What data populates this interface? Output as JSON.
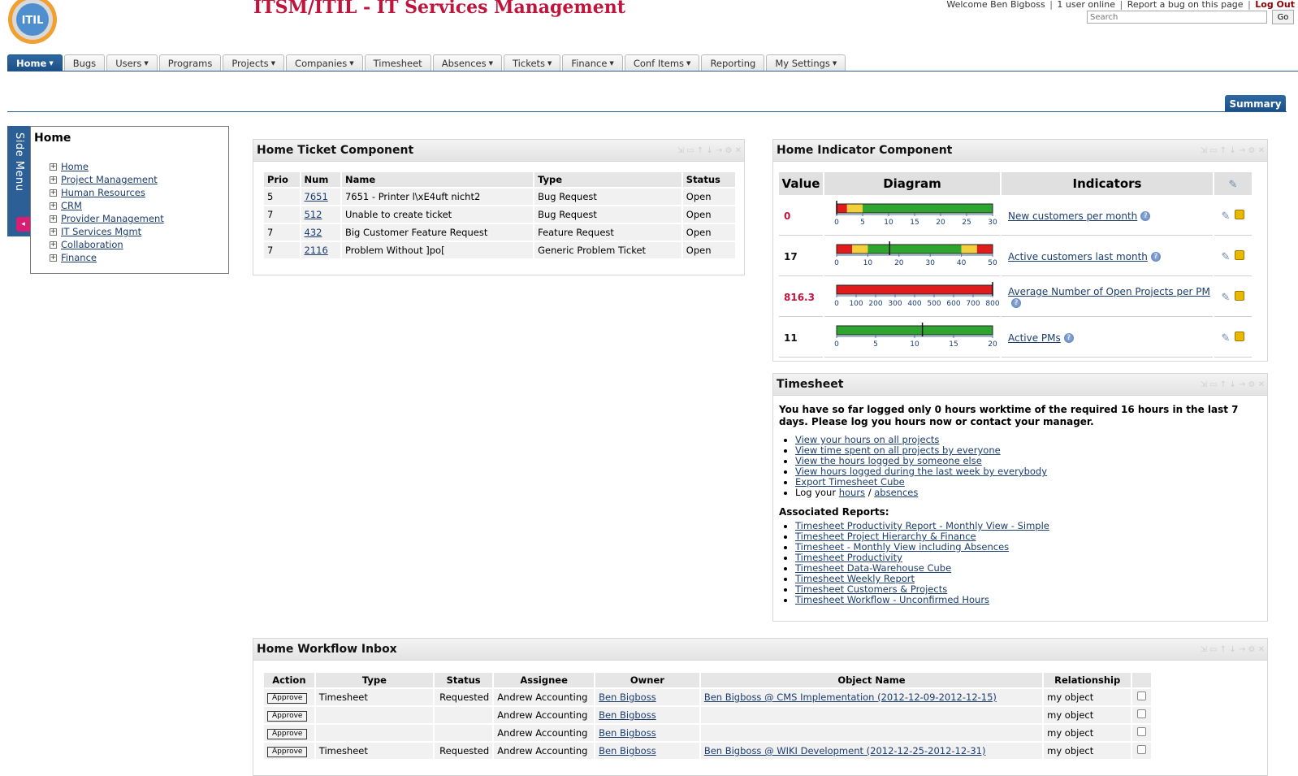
{
  "header": {
    "title": "ITSM/ITIL - IT Services Management",
    "logo_text": "ITIL",
    "welcome": "Welcome Ben Bigboss",
    "users_online": "1 user online",
    "report_bug": "Report a bug on this page",
    "logout": "Log Out",
    "search_placeholder": "Search",
    "go_label": "Go"
  },
  "nav": {
    "tabs": [
      {
        "label": "Home",
        "dropdown": true
      },
      {
        "label": "Bugs",
        "dropdown": false
      },
      {
        "label": "Users",
        "dropdown": true
      },
      {
        "label": "Programs",
        "dropdown": false
      },
      {
        "label": "Projects",
        "dropdown": true
      },
      {
        "label": "Companies",
        "dropdown": true
      },
      {
        "label": "Timesheet",
        "dropdown": false
      },
      {
        "label": "Absences",
        "dropdown": true
      },
      {
        "label": "Tickets",
        "dropdown": true
      },
      {
        "label": "Finance",
        "dropdown": true
      },
      {
        "label": "Conf Items",
        "dropdown": true
      },
      {
        "label": "Reporting",
        "dropdown": false
      },
      {
        "label": "My Settings",
        "dropdown": true
      }
    ],
    "active_tab": "Home",
    "subtab": "Summary"
  },
  "side_menu": {
    "handle_label": "Side Menu",
    "title": "Home",
    "items": [
      "Home",
      "Project Management",
      "Human Resources",
      "CRM",
      "Provider Management",
      "IT Services Mgmt",
      "Collaboration",
      "Finance"
    ]
  },
  "tickets": {
    "title": "Home Ticket Component",
    "columns": [
      "Prio",
      "Num",
      "Name",
      "Type",
      "Status"
    ],
    "rows": [
      {
        "prio": "5",
        "num": "7651",
        "name": "7651 - Printer l\\xE4uft nicht2",
        "type": "Bug Request",
        "status": "Open"
      },
      {
        "prio": "7",
        "num": "512",
        "name": "Unable to create ticket",
        "type": "Bug Request",
        "status": "Open"
      },
      {
        "prio": "7",
        "num": "432",
        "name": "Big Customer Feature Request",
        "type": "Feature Request",
        "status": "Open"
      },
      {
        "prio": "7",
        "num": "2116",
        "name": "Problem Without ]po[",
        "type": "Generic Problem Ticket",
        "status": "Open"
      }
    ]
  },
  "indicators": {
    "title": "Home Indicator Component",
    "columns": [
      "Value",
      "Diagram",
      "Indicators"
    ],
    "rows": [
      {
        "value": "0",
        "value_color": "#c0143c",
        "name": "New customers per month",
        "min": 0,
        "max": 30,
        "ticks": [
          "0",
          "5",
          "10",
          "15",
          "20",
          "25",
          "30"
        ],
        "marker": 0,
        "bands": [
          {
            "to": 2,
            "color": "#e01b1b"
          },
          {
            "to": 5,
            "color": "#f2d03b"
          },
          {
            "to": 30,
            "color": "#2ea52e"
          }
        ]
      },
      {
        "value": "17",
        "value_color": "#111111",
        "name": "Active customers last month",
        "min": 0,
        "max": 50,
        "ticks": [
          "0",
          "10",
          "20",
          "30",
          "40",
          "50"
        ],
        "marker": 17,
        "bands": [
          {
            "to": 5,
            "color": "#e01b1b"
          },
          {
            "to": 10,
            "color": "#f2d03b"
          },
          {
            "to": 40,
            "color": "#2ea52e"
          },
          {
            "to": 45,
            "color": "#f2d03b"
          },
          {
            "to": 50,
            "color": "#e01b1b"
          }
        ]
      },
      {
        "value": "816.3",
        "value_color": "#c0143c",
        "name": "Average Number of Open Projects per PM",
        "min": 0,
        "max": 800,
        "ticks": [
          "0",
          "100",
          "200",
          "300",
          "400",
          "500",
          "600",
          "700",
          "800"
        ],
        "marker": 800,
        "bands": [
          {
            "to": 800,
            "color": "#e01b1b"
          }
        ]
      },
      {
        "value": "11",
        "value_color": "#111111",
        "name": "Active PMs",
        "min": 0,
        "max": 20,
        "ticks": [
          "0",
          "5",
          "10",
          "15",
          "20"
        ],
        "marker": 11,
        "bands": [
          {
            "to": 20,
            "color": "#2ea52e"
          }
        ]
      }
    ]
  },
  "timesheet": {
    "title": "Timesheet",
    "message": "You have so far logged only 0 hours worktime of the required 16 hours in the last 7 days. Please log you hours now or contact your manager.",
    "links": [
      "View your hours on all projects",
      "View time spent on all projects by everyone",
      "View the hours logged by someone else",
      "View hours logged during the last week by everybody",
      "Export Timesheet Cube"
    ],
    "log_your": "Log your",
    "log_hours": "hours",
    "log_sep": "/",
    "log_absences": "absences",
    "reports_heading": "Associated Reports:",
    "reports": [
      "Timesheet Productivity Report - Monthly View - Simple",
      "Timesheet Project Hierarchy & Finance",
      "Timesheet - Monthly View including Absences",
      "Timesheet Productivity",
      "Timesheet Data-Warehouse Cube",
      "Timesheet Weekly Report",
      "Timesheet Customers & Projects",
      "Timesheet Workflow - Unconfirmed Hours"
    ]
  },
  "workflow": {
    "title": "Home Workflow Inbox",
    "columns": [
      "Action",
      "Type",
      "Status",
      "Assignee",
      "Owner",
      "Object Name",
      "Relationship"
    ],
    "approve_label": "Approve",
    "rows": [
      {
        "type": "Timesheet",
        "status": "Requested",
        "assignee": "Andrew Accounting",
        "owner": "Ben Bigboss",
        "object": "Ben Bigboss @ CMS Implementation (2012-12-09-2012-12-15)",
        "relationship": "my object"
      },
      {
        "type": "",
        "status": "",
        "assignee": "Andrew Accounting",
        "owner": "Ben Bigboss",
        "object": "",
        "relationship": "my object"
      },
      {
        "type": "",
        "status": "",
        "assignee": "Andrew Accounting",
        "owner": "Ben Bigboss",
        "object": "",
        "relationship": "my object"
      },
      {
        "type": "Timesheet",
        "status": "Requested",
        "assignee": "Andrew Accounting",
        "owner": "Ben Bigboss",
        "object": "Ben Bigboss @ WIKI Development (2012-12-25-2012-12-31)",
        "relationship": "my object"
      }
    ]
  }
}
